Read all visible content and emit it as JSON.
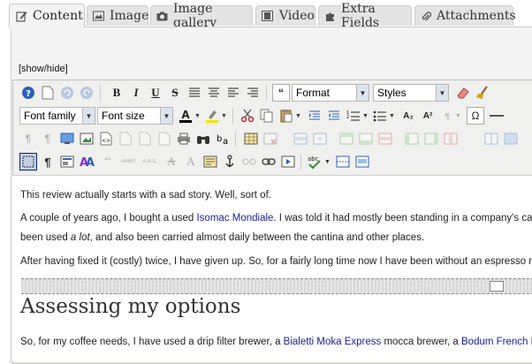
{
  "tabs": [
    {
      "label": "Content",
      "icon": "pencil-icon",
      "active": true
    },
    {
      "label": "Image",
      "icon": "image-icon",
      "active": false
    },
    {
      "label": "Image gallery",
      "icon": "camera-icon",
      "active": false
    },
    {
      "label": "Video",
      "icon": "film-icon",
      "active": false
    },
    {
      "label": "Extra Fields",
      "icon": "puzzle-icon",
      "active": false
    },
    {
      "label": "Attachments",
      "icon": "paperclip-icon",
      "active": false
    }
  ],
  "editor": {
    "showhide": "[show/hide]",
    "toolbar": {
      "format_dropdown": "Format",
      "styles_dropdown": "Styles",
      "font_family_dropdown": "Font family",
      "font_size_dropdown": "Font size",
      "bold": "B",
      "italic": "I",
      "underline": "U",
      "strike": "S",
      "subscript": "A₂",
      "superscript": "A²",
      "omega": "Ω",
      "abbr": "ABBR",
      "acronym": "A.B.C.",
      "quote_marks": "“”",
      "spellcheck": "abc"
    }
  },
  "content": {
    "p1": "This review actually starts with a sad story. Well, sort of.",
    "p2_start": "A couple of years ago, I bought a used ",
    "p2_link": "Isomac Mondiale",
    "p2_end": ". I was told it had mostly been standing in a company's cantina",
    "p3_start": "been used ",
    "p3_em": "a lot",
    "p3_end": ", and also been carried almost daily between the cantina and other places.",
    "p4": "After having fixed it (costly) twice, I have given up. So, for a fairly long time now I have been without an espresso machi",
    "heading": "Assessing my options",
    "p5_start": "So, for my coffee needs, I have used a drip filter brewer, a ",
    "p5_link1": "Bialetti Moka Express",
    "p5_mid": " mocca brewer, a ",
    "p5_link2": "Bodum French Press"
  }
}
